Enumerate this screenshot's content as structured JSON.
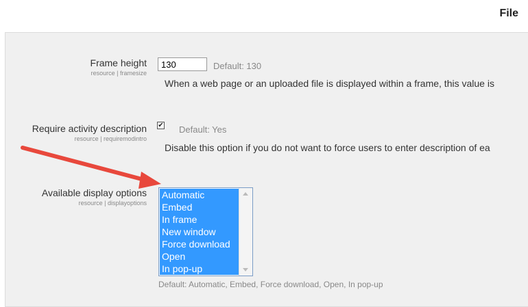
{
  "header": {
    "title": "File"
  },
  "frame_height": {
    "label": "Frame height",
    "sublabel": "resource | framesize",
    "value": "130",
    "default": "Default: 130",
    "description": "When a web page or an uploaded file is displayed within a frame, this value is"
  },
  "require_description": {
    "label": "Require activity description",
    "sublabel": "resource | requiremodintro",
    "checked": true,
    "default": "Default: Yes",
    "description": "Disable this option if you do not want to force users to enter description of ea"
  },
  "display_options": {
    "label": "Available display options",
    "sublabel": "resource | displayoptions",
    "options": [
      "Automatic",
      "Embed",
      "In frame",
      "New window",
      "Force download",
      "Open",
      "In pop-up"
    ],
    "default": "Default: Automatic, Embed, Force download, Open, In pop-up"
  },
  "colors": {
    "selection": "#3399ff",
    "annotation_arrow": "#e8483c"
  },
  "icons": {
    "checkbox_mark": "check-icon",
    "scroll_up": "chevron-up-icon",
    "scroll_down": "chevron-down-icon"
  }
}
